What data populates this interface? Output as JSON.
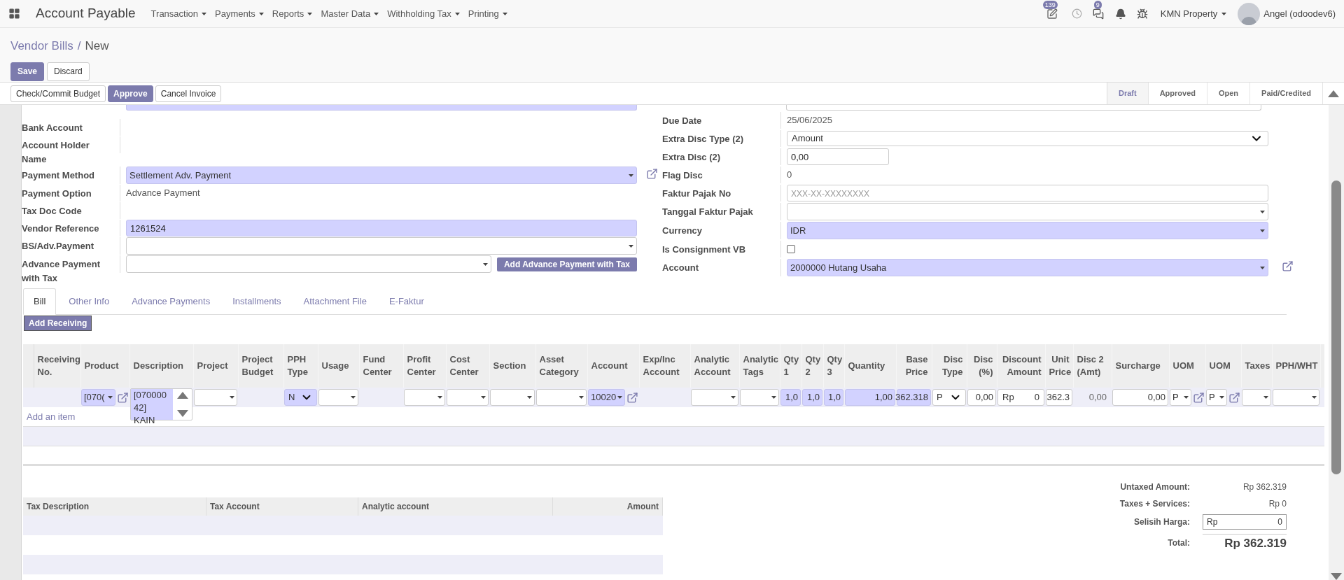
{
  "navbar": {
    "app_title": "Account Payable",
    "menus": [
      "Transaction",
      "Payments",
      "Reports",
      "Master Data",
      "Withholding Tax",
      "Printing"
    ],
    "activity_count": "139",
    "message_count": "9",
    "company": "KMN Property",
    "user": "Angel (odoodev6)"
  },
  "breadcrumb": {
    "parent": "Vendor Bills",
    "separator": "/",
    "current": "New"
  },
  "control_buttons": [
    {
      "label": "Save",
      "primary": true
    },
    {
      "label": "Discard",
      "primary": false
    }
  ],
  "header_buttons": [
    {
      "label": "Check/Commit Budget",
      "primary": false
    },
    {
      "label": "Approve",
      "primary": true
    },
    {
      "label": "Cancel Invoice",
      "primary": false
    }
  ],
  "statusbar": [
    {
      "label": "Draft",
      "selected": true
    },
    {
      "label": "Approved",
      "selected": false
    },
    {
      "label": "Open",
      "selected": false
    },
    {
      "label": "Paid/Credited",
      "selected": false
    }
  ],
  "left_fields": [
    {
      "label": "Bank Account",
      "kind": "text"
    },
    {
      "label": "Account Holder Name",
      "kind": "text"
    },
    {
      "label": "Payment Method",
      "kind": "select",
      "value": "Settlement Adv. Payment",
      "required": true,
      "link": true
    },
    {
      "label": "Payment Option",
      "kind": "text",
      "value": "Advance Payment"
    },
    {
      "label": "Tax Doc Code",
      "kind": "text"
    },
    {
      "label": "Vendor Reference",
      "kind": "input",
      "value": "1261524",
      "required": true
    },
    {
      "label": "BS/Adv.Payment",
      "kind": "select",
      "required": false
    },
    {
      "label": "Advance Payment with Tax",
      "kind": "select",
      "required": false,
      "button": "Add Advance Payment with Tax"
    }
  ],
  "right_fields": [
    {
      "label": "Due Date",
      "kind": "text",
      "value": "25/06/2025"
    },
    {
      "label": "Extra Disc Type (2)",
      "kind": "chevron",
      "value": "Amount",
      "required": false
    },
    {
      "label": "Extra Disc (2)",
      "kind": "number",
      "value": "0,00",
      "required": false
    },
    {
      "label": "Flag Disc",
      "kind": "text",
      "value": "0"
    },
    {
      "label": "Faktur Pajak No",
      "kind": "input",
      "placeholder": "XXX-XX-XXXXXXXX",
      "required": false
    },
    {
      "label": "Tanggal Faktur Pajak",
      "kind": "select",
      "required": false
    },
    {
      "label": "Currency",
      "kind": "select",
      "value": "IDR",
      "required": true
    },
    {
      "label": "Is Consignment VB",
      "kind": "checkbox",
      "checked": false
    },
    {
      "label": "Account",
      "kind": "select",
      "value": "2000000 Hutang Usaha",
      "required": true,
      "link": true
    }
  ],
  "tabs": [
    {
      "label": "Bill",
      "selected": true
    },
    {
      "label": "Other Info",
      "selected": false
    },
    {
      "label": "Advance Payments",
      "selected": false
    },
    {
      "label": "Installments",
      "selected": false
    },
    {
      "label": "Attachment File",
      "selected": false
    },
    {
      "label": "E-Faktur",
      "selected": false
    }
  ],
  "add_receiving_button": "Add Receiving",
  "lines_table": {
    "columns": [
      "Receiving No.",
      "Product",
      "Description",
      "Project",
      "Project Budget",
      "PPH Type",
      "Usage",
      "Fund Center",
      "Profit Center",
      "Cost Center",
      "Section",
      "Asset Category",
      "Account",
      "Exp/Inc Account",
      "Analytic Account",
      "Analytic Tags",
      "Qty 1",
      "Qty 2",
      "Qty 3",
      "Quantity",
      "Base Price",
      "Disc Type",
      "Disc (%)",
      "Discount Amount",
      "Unit Price",
      "Disc 2 (Amt)",
      "Surcharge",
      "UOM",
      "UOM",
      "Taxes",
      "PPH/WHT"
    ],
    "rows": [
      [
        {
          "kind": "blank"
        },
        {
          "kind": "dropdown",
          "value": "[070(",
          "required": true,
          "link": true
        },
        {
          "kind": "textarea",
          "value": "[070000 42] KAIN",
          "required": true
        },
        {
          "kind": "dropdown",
          "required": false
        },
        {
          "kind": "blank"
        },
        {
          "kind": "chevron",
          "value": "N",
          "required": true
        },
        {
          "kind": "dropdown",
          "required": false
        },
        {
          "kind": "blank"
        },
        {
          "kind": "dropdown",
          "required": false
        },
        {
          "kind": "dropdown",
          "required": false
        },
        {
          "kind": "dropdown",
          "required": false
        },
        {
          "kind": "dropdown",
          "required": false
        },
        {
          "kind": "dropdown",
          "value": "10020",
          "required": true,
          "link": true
        },
        {
          "kind": "blank"
        },
        {
          "kind": "dropdown",
          "required": false
        },
        {
          "kind": "dropdown",
          "required": false
        },
        {
          "kind": "input",
          "value": "1,0",
          "required": true
        },
        {
          "kind": "input",
          "value": "1,0",
          "required": true
        },
        {
          "kind": "input",
          "value": "1,0",
          "required": true
        },
        {
          "kind": "input",
          "value": "1,00",
          "required": true
        },
        {
          "kind": "input",
          "value": "362.318",
          "required": true
        },
        {
          "kind": "chevron",
          "value": "P",
          "required": false
        },
        {
          "kind": "input",
          "value": "0,00",
          "required": false
        },
        {
          "kind": "money",
          "currency": "Rp",
          "value": "0",
          "required": false
        },
        {
          "kind": "input",
          "value": "362.3",
          "required": false
        },
        {
          "kind": "text",
          "value": "0,00"
        },
        {
          "kind": "input",
          "value": "0,00",
          "required": false
        },
        {
          "kind": "dropdown",
          "value": "P",
          "required": false,
          "link": true
        },
        {
          "kind": "dropdown",
          "value": "P",
          "required": false,
          "link": true
        },
        {
          "kind": "dropdown",
          "required": false
        },
        {
          "kind": "dropdown",
          "required": false
        }
      ]
    ],
    "add_item": "Add an item"
  },
  "tax_table": {
    "columns": [
      "Tax Description",
      "Tax Account",
      "Analytic account",
      "Amount"
    ]
  },
  "totals": [
    {
      "label": "Untaxed Amount:",
      "kind": "text",
      "value": "Rp 362.319"
    },
    {
      "label": "Taxes + Services:",
      "kind": "text",
      "value": "Rp 0"
    },
    {
      "label": "Selisih Harga:",
      "kind": "money",
      "currency": "Rp",
      "value": "0"
    },
    {
      "label": "Total:",
      "kind": "grand",
      "value": "Rp 362.319"
    }
  ]
}
